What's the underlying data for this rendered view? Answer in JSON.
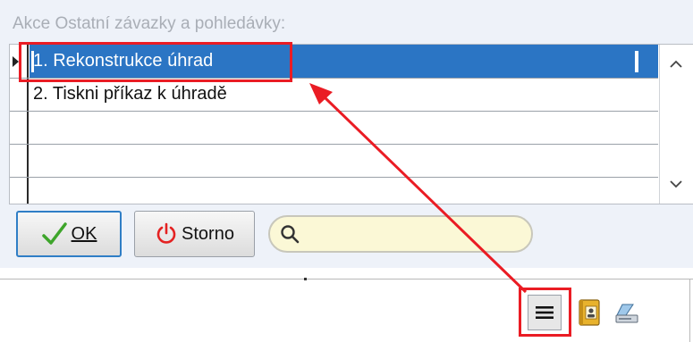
{
  "dialog": {
    "title": "Akce Ostatní závazky a pohledávky:"
  },
  "list": {
    "items": [
      {
        "label": "1. Rekonstrukce úhrad",
        "selected": true
      },
      {
        "label": "2. Tiskni příkaz k úhradě",
        "selected": false
      },
      {
        "label": "",
        "selected": false
      },
      {
        "label": "",
        "selected": false
      }
    ]
  },
  "buttons": {
    "ok": {
      "icon": "checkmark-icon",
      "label": "OK"
    },
    "storno": {
      "icon": "power-icon",
      "label": "Storno"
    }
  },
  "search": {
    "icon": "search-icon",
    "value": "",
    "placeholder": ""
  },
  "toolbar": {
    "icons": [
      "menu-icon",
      "contacts-icon",
      "scanner-icon"
    ]
  },
  "colors": {
    "selection": "#2b75c4",
    "annotation": "#ea1c24",
    "search_bg": "#fbf8d6",
    "ok_check": "#3ea52b",
    "storno_power": "#e42222"
  }
}
